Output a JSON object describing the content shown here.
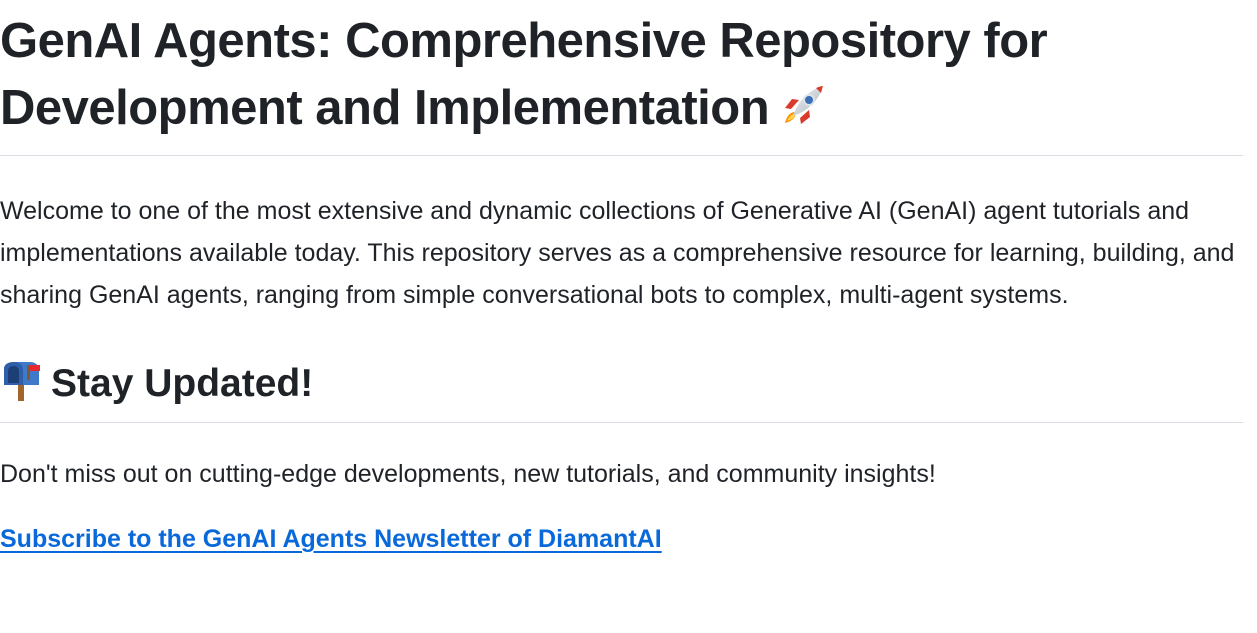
{
  "document": {
    "title": "GenAI Agents: Comprehensive Repository for Development and Implementation",
    "title_emoji_icon": "rocket-icon",
    "intro": "Welcome to one of the most extensive and dynamic collections of Generative AI (GenAI) agent tutorials and implementations available today. This repository serves as a comprehensive resource for learning, building, and sharing GenAI agents, ranging from simple conversational bots to complex, multi-agent systems.",
    "stay_updated": {
      "heading": "Stay Updated!",
      "heading_icon": "mailbox-icon",
      "text": "Don't miss out on cutting-edge developments, new tutorials, and community insights!",
      "link_text": "Subscribe to the GenAI Agents Newsletter of DiamantAI"
    }
  },
  "colors": {
    "text": "#1f2328",
    "link": "#0969da",
    "divider": "#d8dee4"
  }
}
